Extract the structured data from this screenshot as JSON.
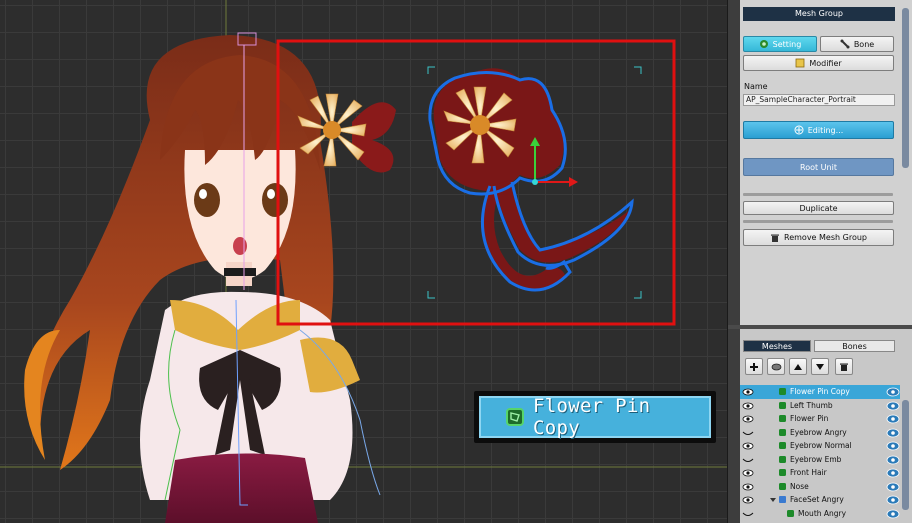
{
  "panel": {
    "title": "Mesh Group",
    "buttons": {
      "setting": "Setting",
      "bone": "Bone",
      "modifier": "Modifier",
      "editing": "Editing...",
      "root_unit": "Root Unit",
      "duplicate": "Duplicate",
      "remove": "Remove Mesh Group"
    },
    "name_label": "Name",
    "name_value": "AP_SampleCharacter_Portrait"
  },
  "lower_panel": {
    "tabs": {
      "meshes": "Meshes",
      "bones": "Bones"
    },
    "items": [
      {
        "label": "Flower Pin Copy",
        "selected": true,
        "eye": "open"
      },
      {
        "label": "Left Thumb",
        "selected": false,
        "eye": "open"
      },
      {
        "label": "Flower Pin",
        "selected": false,
        "eye": "open"
      },
      {
        "label": "Eyebrow Angry",
        "selected": false,
        "eye": "closed"
      },
      {
        "label": "Eyebrow Normal",
        "selected": false,
        "eye": "open"
      },
      {
        "label": "Eyebrow Emb",
        "selected": false,
        "eye": "closed"
      },
      {
        "label": "Front Hair",
        "selected": false,
        "eye": "open"
      },
      {
        "label": "Nose",
        "selected": false,
        "eye": "open"
      },
      {
        "label": "FaceSet Angry",
        "selected": false,
        "eye": "open",
        "group": true
      },
      {
        "label": "Mouth Angry",
        "selected": false,
        "eye": "closed",
        "indent": true
      }
    ]
  },
  "callout": {
    "text": "Flower Pin Copy"
  },
  "colors": {
    "accent": "#3aa6d8",
    "selection_box": "#e01010",
    "mesh_outline": "#1a6ee6",
    "panel_title": "#1e3145"
  }
}
